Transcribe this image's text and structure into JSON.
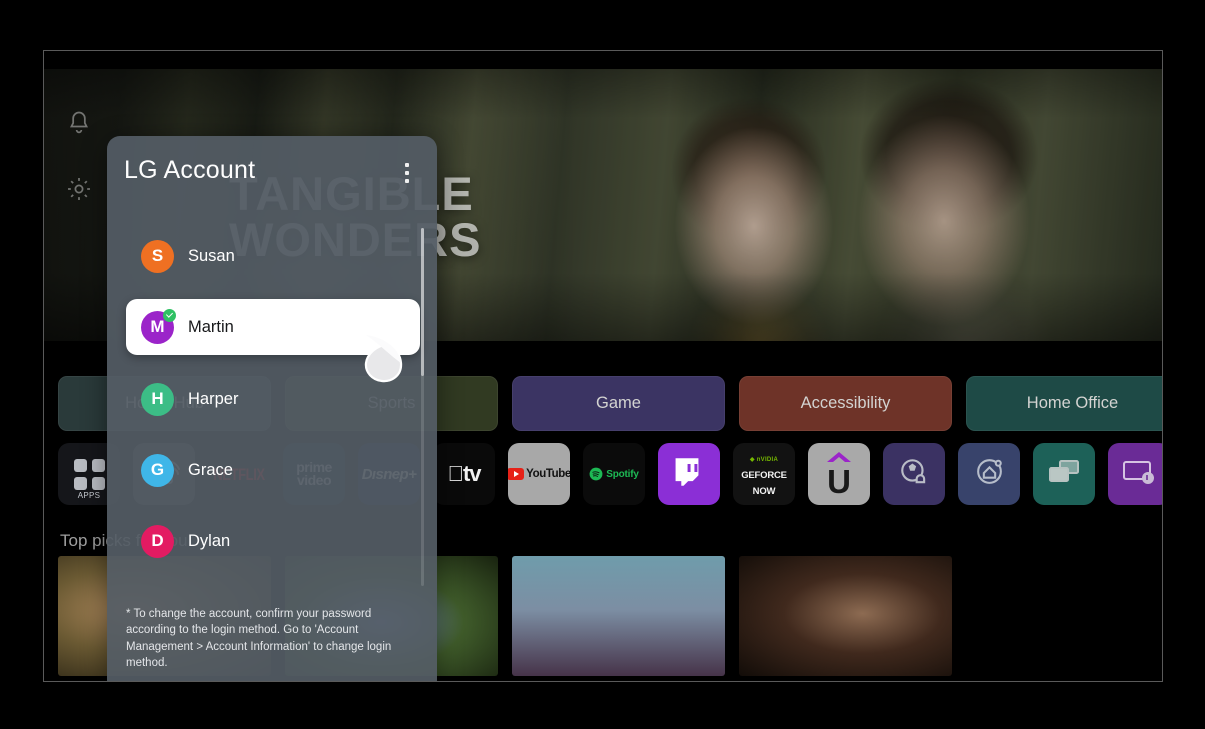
{
  "hero": {
    "title": "TANGIBLE WONDERS"
  },
  "side_rail": [
    {
      "name": "notifications-icon",
      "icon": "bell-icon"
    },
    {
      "name": "settings-icon",
      "icon": "gear-icon"
    }
  ],
  "categories": [
    {
      "label": "Home Hub",
      "color": "#2a3a3a"
    },
    {
      "label": "Sports",
      "color": "#313a22"
    },
    {
      "label": "Game",
      "color": "#3b3463"
    },
    {
      "label": "Accessibility",
      "color": "#6e3328"
    },
    {
      "label": "Home Office",
      "color": "#1e4a46"
    }
  ],
  "apps": [
    {
      "label": "APPS",
      "icon": "apps-grid-icon",
      "bg": "#15161a"
    },
    {
      "label": "LG Channels",
      "icon": "lg-channels-icon",
      "bg": "#3b3c40"
    },
    {
      "label": "NETFLIX",
      "icon": "netflix-icon",
      "bg": "#0a0a0a"
    },
    {
      "label": "prime video",
      "icon": "prime-video-icon",
      "bg": "#0d1b2a"
    },
    {
      "label": "Disney+",
      "icon": "disney-plus-icon",
      "bg": "#061736"
    },
    {
      "label": "Apple TV",
      "icon": "apple-tv-icon",
      "bg": "#0a0a0a"
    },
    {
      "label": "YouTube",
      "icon": "youtube-icon",
      "bg": "#a8a8a8"
    },
    {
      "label": "Spotify",
      "icon": "spotify-icon",
      "bg": "#0b0b0b"
    },
    {
      "label": "Twitch",
      "icon": "twitch-icon",
      "bg": "#8b2fd6"
    },
    {
      "label": "GeForce NOW",
      "icon": "geforce-now-icon",
      "bg": "#121212"
    },
    {
      "label": "U+",
      "icon": "uplus-icon",
      "bg": "#a9a9a9"
    },
    {
      "label": "Sports Alert",
      "icon": "sports-alert-icon",
      "bg": "#3b3263"
    },
    {
      "label": "Home Hub App",
      "icon": "home-hub-icon",
      "bg": "#38436b"
    },
    {
      "label": "Screen Share",
      "icon": "screen-share-icon",
      "bg": "#1d6158"
    },
    {
      "label": "Music Player",
      "icon": "music-player-icon",
      "bg": "#6a2b96"
    }
  ],
  "top_picks": {
    "label": "Top picks for you",
    "cards": [
      {
        "name": "giraffe-card",
        "from": "#6b5a33",
        "to": "#2a2414"
      },
      {
        "name": "meadow-card",
        "from": "#3f5b2a",
        "to": "#1b2913"
      },
      {
        "name": "bird-card",
        "from": "#5d8d9e",
        "to": "#2a3d4c"
      },
      {
        "name": "period-card",
        "from": "#4a3426",
        "to": "#170f0a"
      }
    ]
  },
  "account_panel": {
    "title": "LG Account",
    "menu_icon": "more-vertical-icon",
    "accounts": [
      {
        "name": "Susan",
        "initial": "S",
        "color": "#ef7022",
        "selected": false,
        "verified": false
      },
      {
        "name": "Martin",
        "initial": "M",
        "color": "#9b24c9",
        "selected": true,
        "verified": true
      },
      {
        "name": "Harper",
        "initial": "H",
        "color": "#3cbd86",
        "selected": false,
        "verified": false
      },
      {
        "name": "Grace",
        "initial": "G",
        "color": "#3fb6e8",
        "selected": false,
        "verified": false
      },
      {
        "name": "Dylan",
        "initial": "D",
        "color": "#e31b62",
        "selected": false,
        "verified": false
      }
    ],
    "note": "* To change the account, confirm your password according to the login method. Go to 'Account Management > Account Information' to change login method."
  },
  "cursor": {
    "icon": "magic-remote-pointer-icon"
  }
}
